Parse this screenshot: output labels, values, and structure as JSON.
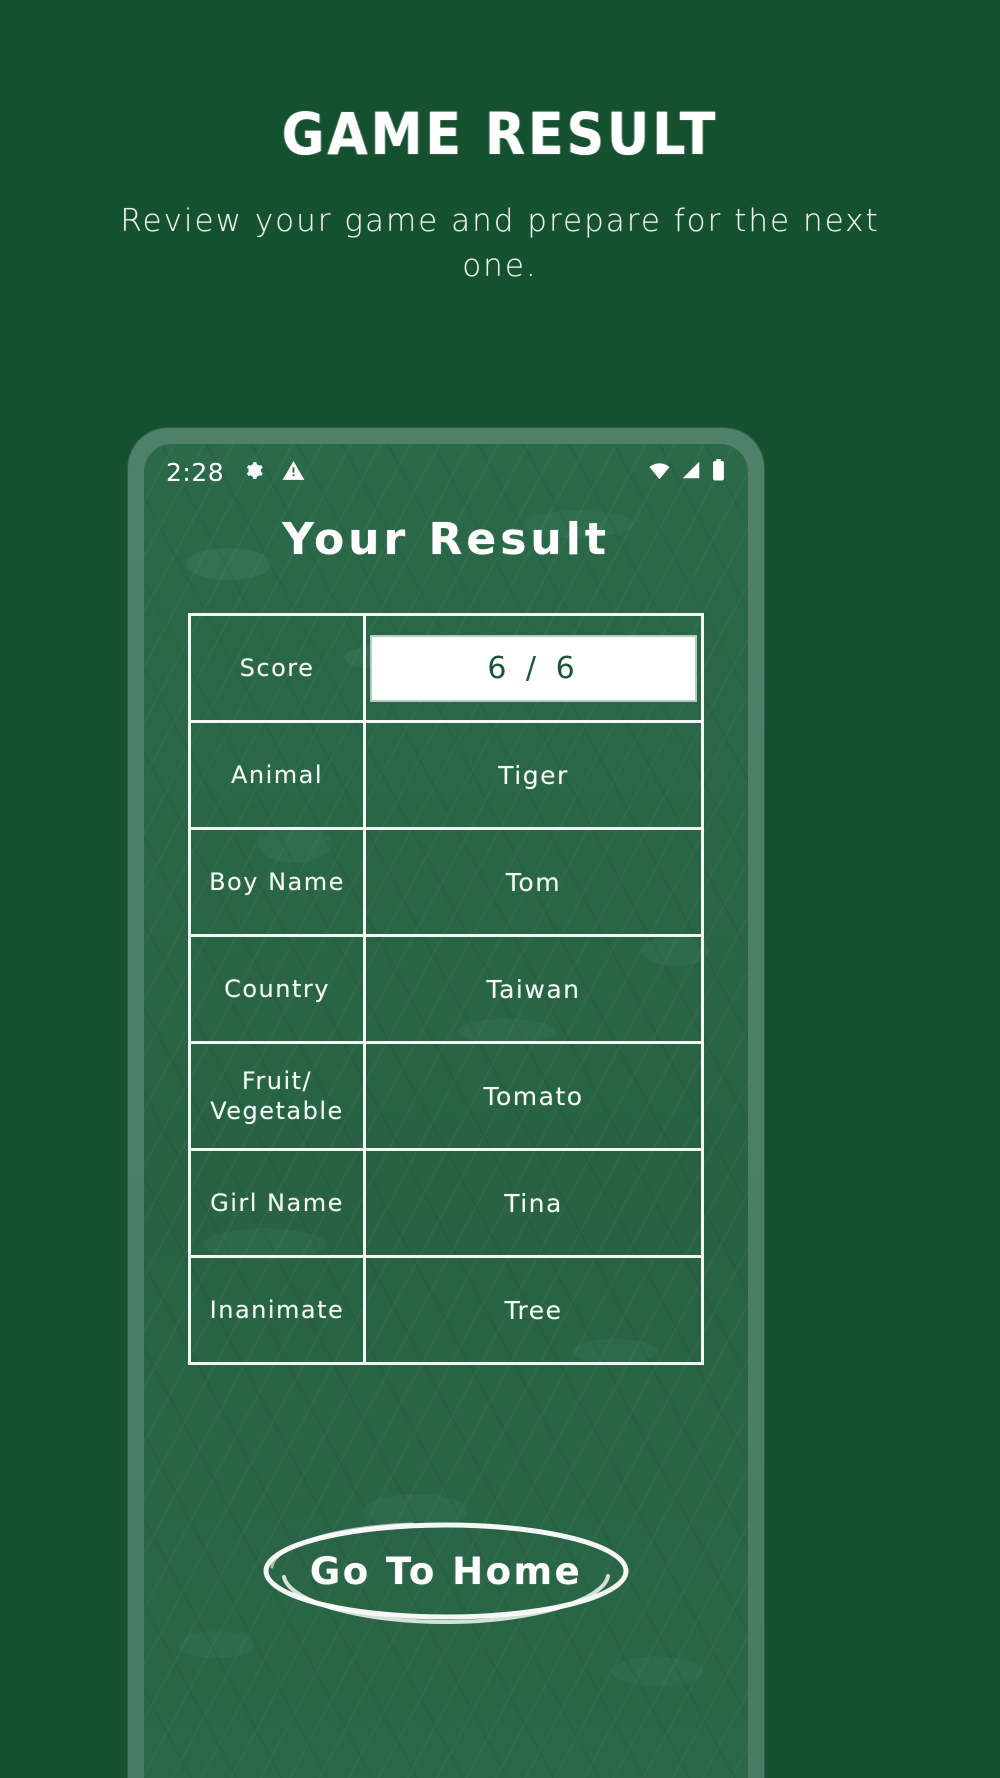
{
  "promo": {
    "title": "GAME RESULT",
    "subtitle": "Review your game and prepare for the next one."
  },
  "phone": {
    "status_bar": {
      "time": "2:28",
      "left_icons": [
        "gear-icon",
        "warning-triangle-icon"
      ],
      "right_icons": [
        "wifi-icon",
        "cellular-signal-icon",
        "battery-icon"
      ]
    },
    "screen_title": "Your Result",
    "result_table": {
      "rows": [
        {
          "label": "Score",
          "value": "6 / 6",
          "highlight": true
        },
        {
          "label": "Animal",
          "value": "Tiger",
          "highlight": false
        },
        {
          "label": "Boy Name",
          "value": "Tom",
          "highlight": false
        },
        {
          "label": "Country",
          "value": "Taiwan",
          "highlight": false
        },
        {
          "label": "Fruit/\nVegetable",
          "value": "Tomato",
          "highlight": false
        },
        {
          "label": "Girl Name",
          "value": "Tina",
          "highlight": false
        },
        {
          "label": "Inanimate",
          "value": "Tree",
          "highlight": false
        }
      ]
    },
    "go_home_button": "Go To Home"
  },
  "colors": {
    "page_background": "#15502f",
    "chalkboard": "#2a6647",
    "phone_bezel": "#4a7a64",
    "chalk_white": "#f4faf5",
    "score_highlight_background": "#ffffff",
    "score_highlight_text": "#1d5537"
  }
}
